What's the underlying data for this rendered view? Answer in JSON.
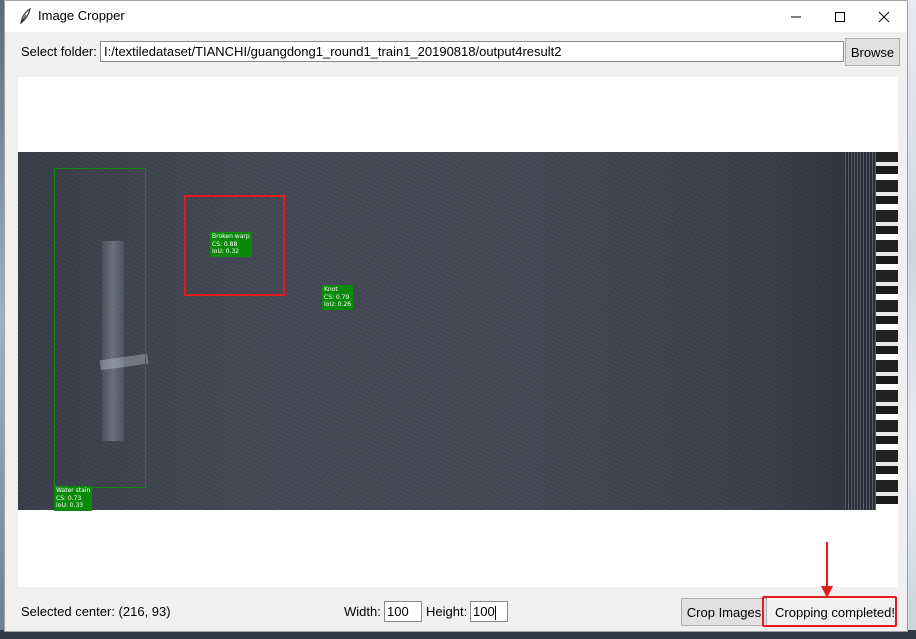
{
  "window": {
    "title": "Image Cropper",
    "icon": "feather-icon",
    "controls": {
      "minimize": "—",
      "maximize": "☐",
      "close": "✕"
    }
  },
  "folder": {
    "label": "Select folder:",
    "path": "I:/textiledataset/TIANCHI/guangdong1_round1_train1_20190818/output4result2",
    "browse_label": "Browse"
  },
  "detections": [
    {
      "label": "Broken warp",
      "cs": "CS: 0.88",
      "iou": "IoU: 0.32"
    },
    {
      "label": "Knot",
      "cs": "CS: 0.79",
      "iou": "IoU: 0.26"
    },
    {
      "label": "Water stain",
      "cs": "CS: 0.73",
      "iou": "IoU: 0.33"
    }
  ],
  "colors": {
    "detection": "#0a8a0a",
    "selection": "#e11d1d",
    "annotation": "#e11d1d"
  },
  "bottom": {
    "center_text": "Selected center: (216, 93)",
    "width_label": "Width:",
    "width_value": "100",
    "height_label": "Height:",
    "height_value": "100",
    "crop_label": "Crop Images",
    "status": "Cropping completed!"
  }
}
